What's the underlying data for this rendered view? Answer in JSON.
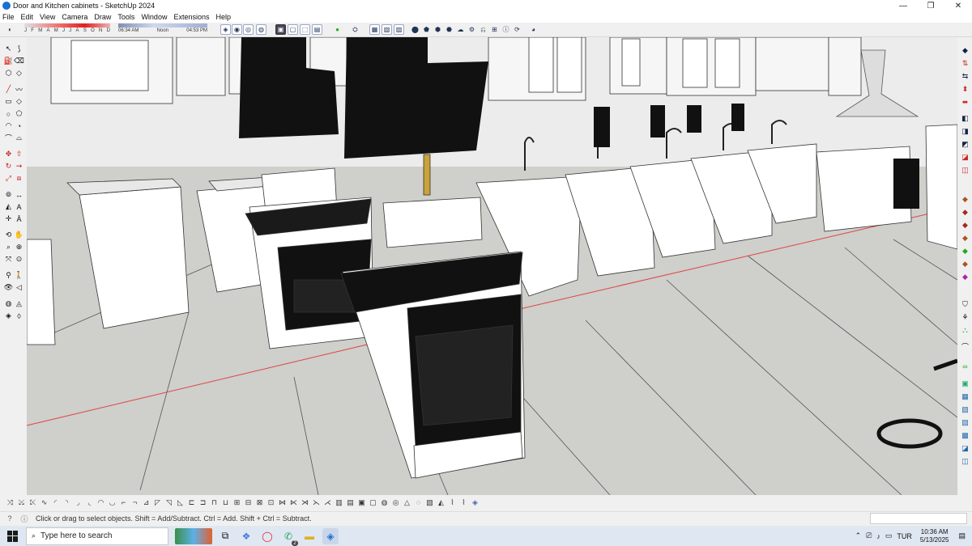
{
  "window": {
    "title": "Door and Kitchen cabinets - SketchUp 2024",
    "controls": {
      "minimize": "—",
      "maximize": "❐",
      "close": "✕"
    }
  },
  "menu": [
    "File",
    "Edit",
    "View",
    "Camera",
    "Draw",
    "Tools",
    "Window",
    "Extensions",
    "Help"
  ],
  "shadows": {
    "months": [
      "J",
      "F",
      "M",
      "A",
      "M",
      "J",
      "J",
      "A",
      "S",
      "O",
      "N",
      "D"
    ],
    "time_start": "06:34 AM",
    "time_mid": "Noon",
    "time_end": "04:53 PM"
  },
  "status": {
    "hint": "Click or drag to select objects. Shift = Add/Subtract. Ctrl = Add. Shift + Ctrl = Subtract.",
    "info_icon": "ⓘ",
    "help_icon": "?"
  },
  "taskbar": {
    "search_placeholder": "Type here to search",
    "language": "TUR",
    "time": "10:36 AM",
    "date": "5/13/2025",
    "whatsapp_badge": "2"
  },
  "colors": {
    "axis_red": "#d44",
    "axis_green": "#3a3",
    "axis_blue": "#44d",
    "sketchup_blue": "#1a6fd1"
  },
  "icons": {
    "left_tools": [
      "select-icon",
      "lasso-icon",
      "paint-bucket-icon",
      "eraser-icon",
      "line-icon",
      "arc-icon",
      "rectangle-icon",
      "circle-icon",
      "push-pull-icon",
      "offset-icon",
      "move-icon",
      "rotate-icon",
      "scale-icon",
      "follow-me-icon",
      "tape-measure-icon",
      "protractor-icon",
      "text-icon",
      "axes-icon",
      "orbit-icon",
      "pan-icon",
      "zoom-icon",
      "zoom-extents-icon",
      "walk-icon",
      "look-around-icon",
      "section-plane-icon"
    ],
    "right_tools": [
      "sandbox-icon",
      "outliner-icon",
      "materials-icon",
      "components-icon",
      "styles-icon",
      "layers-icon",
      "scenes-icon",
      "shadows-icon",
      "fog-icon",
      "soften-icon",
      "instructor-icon",
      "solid-tools-icon"
    ]
  }
}
